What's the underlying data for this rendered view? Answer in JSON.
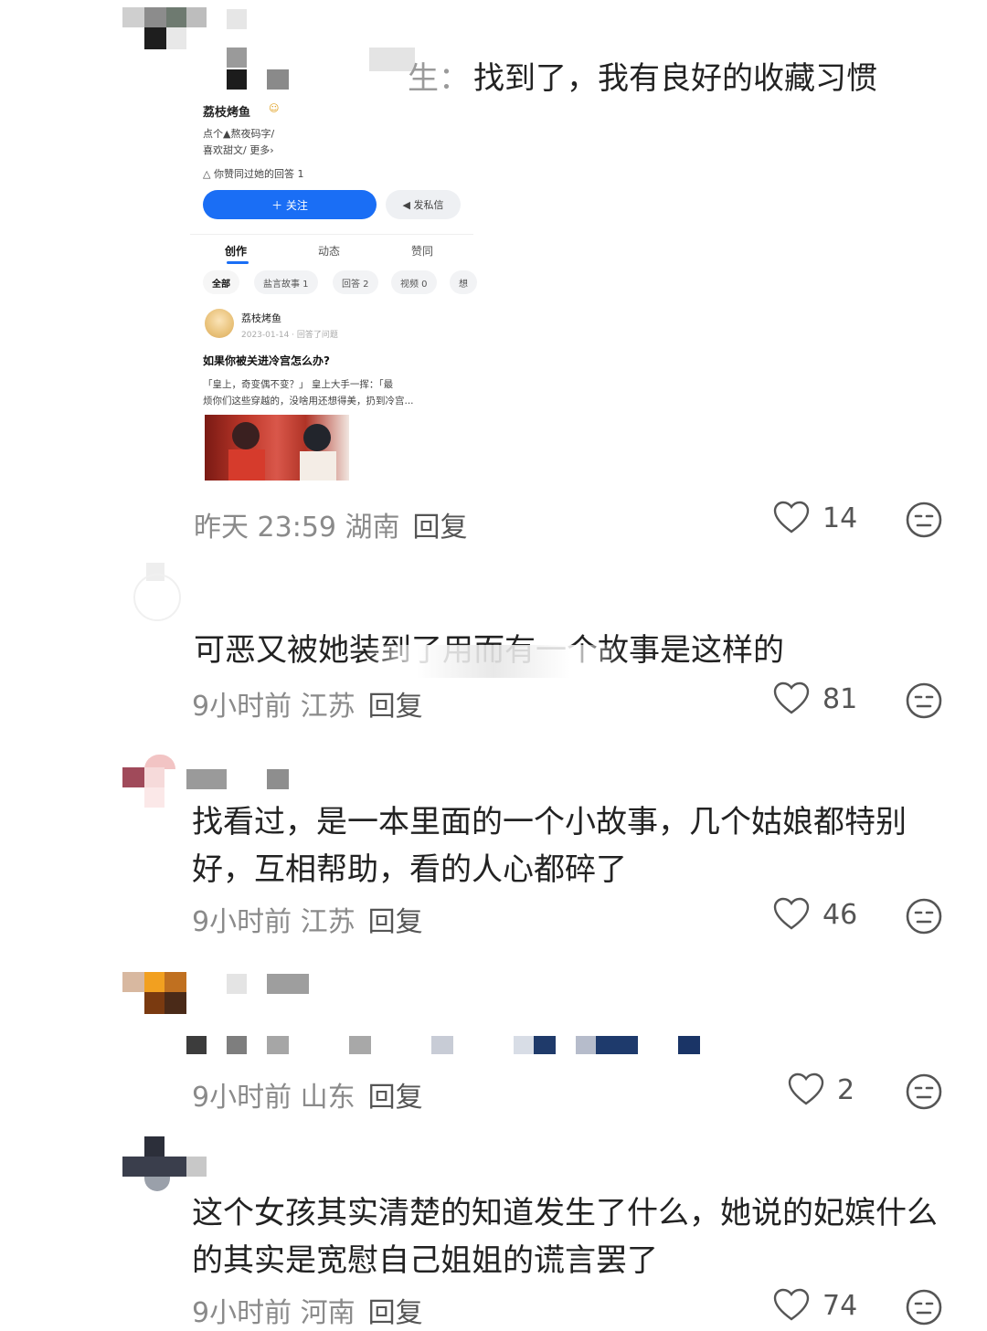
{
  "comments": [
    {
      "name": "生：",
      "text": "找到了，我有良好的收藏习惯",
      "meta": "昨天 23:59 湖南",
      "reply": "回复",
      "likes": "14"
    },
    {
      "text": "可恶又被她装到了用而有一个故事是这样的",
      "meta": "9小时前 江苏",
      "reply": "回复",
      "likes": "81"
    },
    {
      "text": "找看过，是一本里面的一个小故事，几个姑娘都特别好，互相帮助，看的人心都碎了",
      "meta": "9小时前 江苏",
      "reply": "回复",
      "likes": "46"
    },
    {
      "meta": "9小时前 山东",
      "reply": "回复",
      "likes": "2"
    },
    {
      "text": "这个女孩其实清楚的知道发生了什么，她说的妃嫔什么的其实是宽慰自己姐姐的谎言罢了",
      "meta": "9小时前 河南",
      "reply": "回复",
      "likes": "74"
    }
  ],
  "screenshot": {
    "author": "荔枝烤鱼",
    "bio1": "点个▲熬夜码字/",
    "bio2": "喜欢甜文/ 更多›",
    "upvoted": "△ 你赞同过她的回答 1",
    "follow": "＋ 关注",
    "message": "◀ 发私信",
    "tabs": [
      "创作",
      "动态",
      "赞同"
    ],
    "chips": [
      "全部",
      "盐言故事 1",
      "回答 2",
      "视频 0",
      "想"
    ],
    "post_author": "荔枝烤鱼",
    "post_time": "2023-01-14 · 回答了问题",
    "post_title": "如果你被关进冷宫怎么办?",
    "post_line1": "「皇上，奇变偶不变？」 皇上大手一挥：「最",
    "post_line2": "烦你们这些穿越的，没啥用还想得美，扔到冷宫..."
  }
}
